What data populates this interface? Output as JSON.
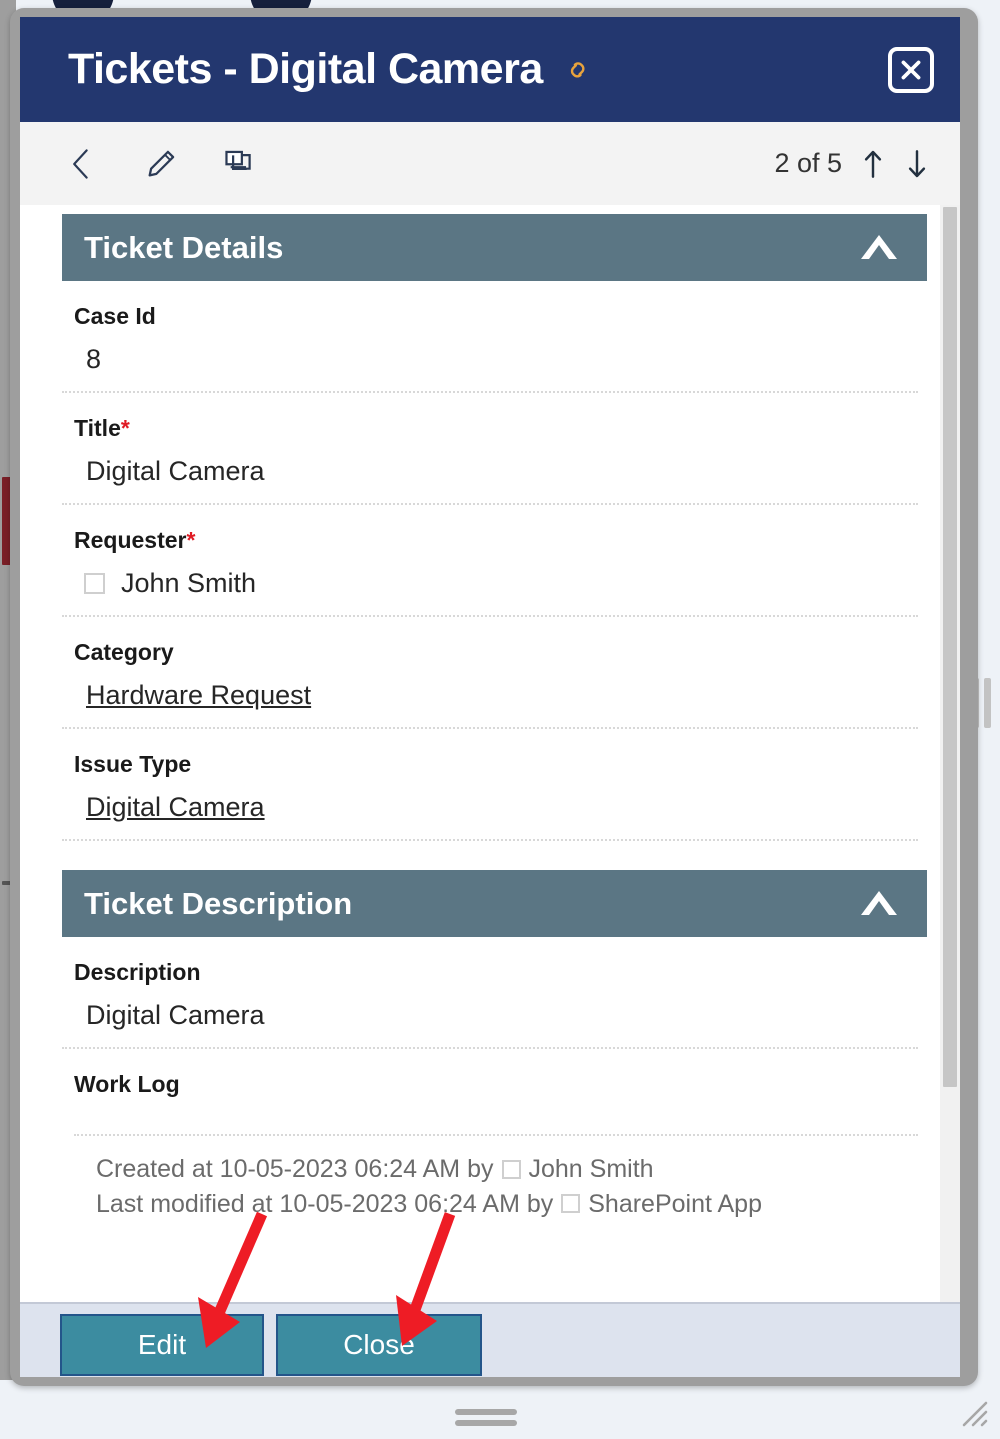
{
  "window": {
    "title": "Tickets - Digital Camera",
    "link_icon": "link-icon",
    "close_icon": "close-icon"
  },
  "toolbar": {
    "back_icon": "back-chevron-icon",
    "edit_icon": "pencil-edit-icon",
    "copy_icon": "duplicate-copy-icon",
    "pager_label": "2 of 5",
    "prev_icon": "arrow-up-icon",
    "next_icon": "arrow-down-icon"
  },
  "sections": {
    "details": {
      "title": "Ticket Details",
      "collapse_icon": "chevron-up-icon",
      "fields": [
        {
          "label": "Case Id",
          "required": "",
          "value": "8",
          "type": "text"
        },
        {
          "label": "Title",
          "required": "*",
          "value": "Digital Camera",
          "type": "text"
        },
        {
          "label": "Requester",
          "required": "*",
          "value": "John Smith",
          "type": "person"
        },
        {
          "label": "Category",
          "required": "",
          "value": "Hardware Request",
          "type": "link"
        },
        {
          "label": "Issue Type",
          "required": "",
          "value": "Digital Camera",
          "type": "link"
        }
      ]
    },
    "description": {
      "title": "Ticket Description",
      "collapse_icon": "chevron-up-icon",
      "fields": [
        {
          "label": "Description",
          "required": "",
          "value": "Digital Camera",
          "type": "text"
        }
      ],
      "worklog": {
        "label": "Work Log",
        "created_prefix": "Created at 10-05-2023 06:24 AM by",
        "created_by": "John Smith",
        "modified_prefix": "Last modified at 10-05-2023 06:24 AM by",
        "modified_by": "SharePoint App"
      }
    }
  },
  "footer": {
    "edit_label": "Edit",
    "close_label": "Close"
  },
  "chrome": {
    "drag_handle": "window-drag-handle",
    "resize_grip": "resize-grip-icon",
    "scrollbar": "vertical-scrollbar"
  },
  "annotations": {
    "arrow_edit": "red-arrow-pointing-to-edit-button",
    "arrow_close": "red-arrow-pointing-to-close-button"
  },
  "colors": {
    "titlebar": "#23376f",
    "section_header": "#5b7684",
    "button": "#3c8ca0",
    "button_border": "#23558a",
    "required": "#e01b24",
    "link_icon": "#e8a33d",
    "footer_bg": "#dde3ee",
    "annotation": "#ee1c25"
  }
}
